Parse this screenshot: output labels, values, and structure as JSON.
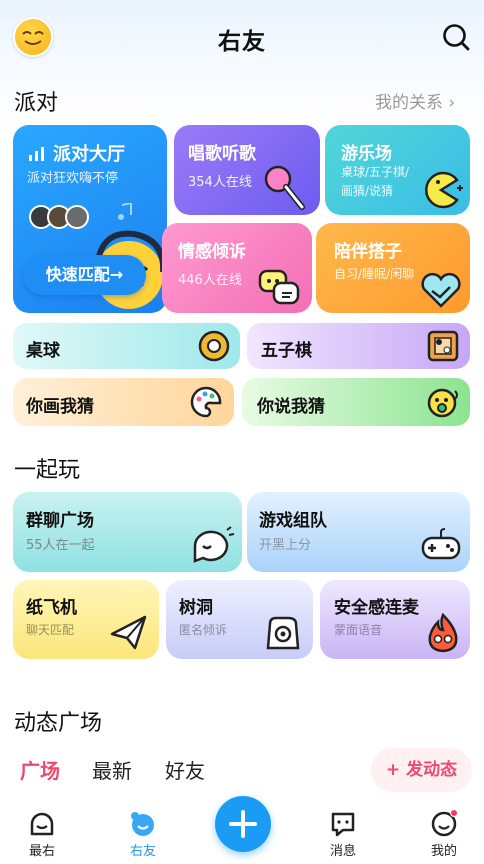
{
  "header": {
    "title": "右友"
  },
  "party": {
    "title": "派对",
    "link": "我的关系",
    "hall": {
      "title": "派对大厅",
      "subtitle": "派对狂欢嗨不停",
      "button": "快速匹配→"
    },
    "sing": {
      "title": "唱歌听歌",
      "subtitle": "354人在线"
    },
    "playground": {
      "title": "游乐场",
      "subtitle": "桌球/五子棋/画猜/说猜"
    },
    "emotion": {
      "title": "情感倾诉",
      "subtitle": "446人在线"
    },
    "buddy": {
      "title": "陪伴搭子",
      "subtitle": "自习/睡眠/闲聊"
    },
    "billiards": {
      "title": "桌球"
    },
    "gomoku": {
      "title": "五子棋"
    },
    "draw_guess": {
      "title": "你画我猜"
    },
    "say_guess": {
      "title": "你说我猜"
    }
  },
  "together": {
    "title": "一起玩",
    "group_chat": {
      "title": "群聊广场",
      "subtitle": "55人在一起"
    },
    "team": {
      "title": "游戏组队",
      "subtitle": "开黑上分"
    },
    "plane": {
      "title": "纸飞机",
      "subtitle": "聊天匹配"
    },
    "treehole": {
      "title": "树洞",
      "subtitle": "匿名倾诉"
    },
    "safe_mic": {
      "title": "安全感连麦",
      "subtitle": "蒙面语音"
    }
  },
  "feed": {
    "title": "动态广场",
    "tabs": [
      "广场",
      "最新",
      "好友"
    ],
    "post_button": "发动态"
  },
  "nav": {
    "items": [
      {
        "label": "最右",
        "icon": "ghost-face-icon"
      },
      {
        "label": "右友",
        "icon": "chat-bubble-face-icon"
      },
      {
        "label": "消息",
        "icon": "message-icon"
      },
      {
        "label": "我的",
        "icon": "profile-icon"
      }
    ]
  },
  "colors": {
    "accent": "#1a9cf5",
    "active_tab": "#f0486e",
    "nav_active": "#2196f3"
  }
}
